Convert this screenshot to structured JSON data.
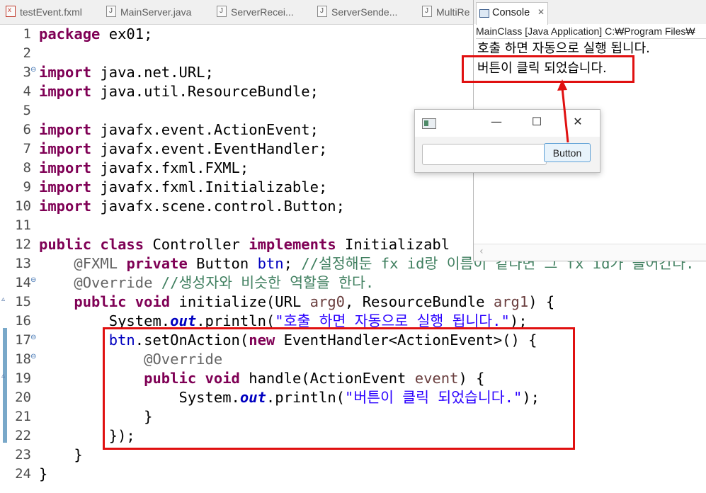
{
  "editor_tabs": [
    {
      "label": "testEvent.fxml",
      "icon": "fxml-file-icon"
    },
    {
      "label": "MainServer.java",
      "icon": "java-file-icon"
    },
    {
      "label": "ServerRecei...",
      "icon": "java-file-icon"
    },
    {
      "label": "ServerSende...",
      "icon": "java-file-icon"
    },
    {
      "label": "MultiRe",
      "icon": "java-file-icon"
    }
  ],
  "console": {
    "tab_label": "Console",
    "close_glyph": "✕",
    "description": "MainClass [Java Application] C:₩Program Files₩",
    "output": [
      "호출 하면 자동으로 실행 됩니다.",
      "버튼이 클릭 되었습니다."
    ],
    "scroll_left_glyph": "‹"
  },
  "fx_window": {
    "minimize_glyph": "—",
    "maximize_glyph": "☐",
    "close_glyph": "✕",
    "button_label": "Button"
  },
  "line_numbers": [
    "1",
    "2",
    "3",
    "4",
    "5",
    "6",
    "7",
    "8",
    "9",
    "10",
    "11",
    "12",
    "13",
    "14",
    "15",
    "16",
    "17",
    "18",
    "19",
    "20",
    "21",
    "22",
    "23",
    "24"
  ],
  "code": {
    "l1": {
      "kw": "package",
      "rest": " ex01;"
    },
    "l3": {
      "kw": "import",
      "rest": " java.net.URL;"
    },
    "l4": {
      "kw": "import",
      "rest": " java.util.ResourceBundle;"
    },
    "l6": {
      "kw": "import",
      "rest": " javafx.event.ActionEvent;"
    },
    "l7": {
      "kw": "import",
      "rest": " javafx.event.EventHandler;"
    },
    "l8": {
      "kw": "import",
      "rest": " javafx.fxml.FXML;"
    },
    "l9": {
      "kw": "import",
      "rest": " javafx.fxml.Initializable;"
    },
    "l10": {
      "kw": "import",
      "rest": " javafx.scene.control.Button;"
    },
    "l12": {
      "kw1": "public",
      "kw2": "class",
      "name": " Controller ",
      "kw3": "implements",
      "rest": " Initializabl"
    },
    "l13": {
      "ann": "@FXML",
      "kw": "private",
      "type": " Button ",
      "field": "btn",
      "semi": "; ",
      "comment": "//설정해둔 fx id랑 이름이 같다면 그 fx id가 들어간다."
    },
    "l14": {
      "ann": "@Override",
      "comment": " //생성자와 비슷한 역할을 한다."
    },
    "l15": {
      "kw1": "public",
      "kw2": "void",
      "mid": " initialize(URL ",
      "p1": "arg0",
      "mid2": ", ResourceBundle ",
      "p2": "arg1",
      "end": ") {"
    },
    "l16": {
      "pre": "System.",
      "out": "out",
      "mid": ".println(",
      "str": "\"호출 하면 자동으로 실행 됩니다.\"",
      "end": ");"
    },
    "l17": {
      "field": "btn",
      "mid": ".setOnAction(",
      "kw": "new",
      "rest": " EventHandler<ActionEvent>() {"
    },
    "l18": {
      "ann": "@Override"
    },
    "l19": {
      "kw1": "public",
      "kw2": "void",
      "mid": " handle(ActionEvent ",
      "p1": "event",
      "end": ") {"
    },
    "l20": {
      "pre": "System.",
      "out": "out",
      "mid": ".println(",
      "str": "\"버튼이 클릭 되었습니다.\"",
      "end": ");"
    },
    "l21": {
      "text": "}"
    },
    "l22": {
      "text": "});"
    },
    "l23": {
      "text": "}"
    },
    "l24": {
      "text": "}"
    }
  },
  "colors": {
    "keyword": "#7f0055",
    "string": "#2a00ff",
    "comment": "#3f7f5f",
    "annotation": "#646464",
    "field": "#0000c0",
    "highlight_box": "#e01010",
    "fx_button_border": "#5fa1d6"
  }
}
